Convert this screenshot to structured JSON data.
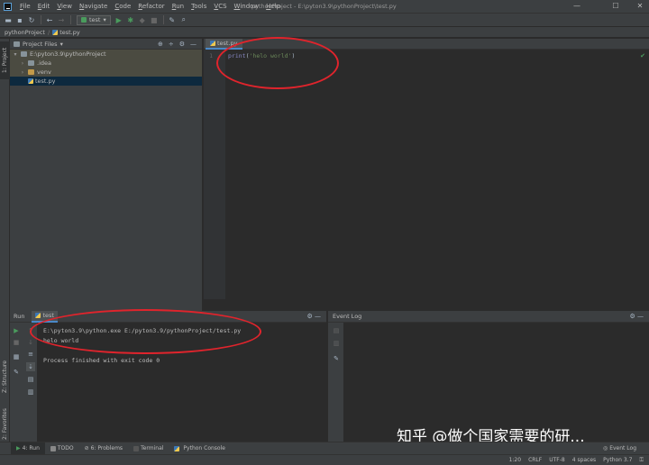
{
  "menubar": {
    "items": [
      "File",
      "Edit",
      "View",
      "Navigate",
      "Code",
      "Refactor",
      "Run",
      "Tools",
      "VCS",
      "Window",
      "Help"
    ],
    "window_title": "pythonProject - E:\\pyton3.9\\pythonProject\\test.py",
    "minimize": "—",
    "maximize": "☐",
    "close": "✕"
  },
  "toolbar": {
    "run_config": "test",
    "run_config_arrow": "▾"
  },
  "breadcrumb": {
    "project": "pythonProject",
    "file": "test.py"
  },
  "left_strip": {
    "project_tab": "1: Project",
    "structure_tab": "Z: Structure",
    "favorites_tab": "2: Favorites"
  },
  "project_panel": {
    "header": "Project Files",
    "header_arrow": "▾",
    "root": "E:\\pyton3.9\\pythonProject",
    "children": [
      ".idea",
      "venv",
      "test.py"
    ]
  },
  "editor": {
    "tab_label": "test.py",
    "line_number": "1",
    "code_fn": "print",
    "code_open": "(",
    "code_string": "'helo world'",
    "code_close": ")"
  },
  "run_panel": {
    "title": "Run",
    "tab_label": "test",
    "console_lines": [
      "E:\\pyton3.9\\python.exe E:/pyton3.9/pythonProject/test.py",
      "helo world",
      "",
      "Process finished with exit code 0"
    ]
  },
  "event_log": {
    "title": "Event Log"
  },
  "tool_tabs": {
    "run": "4: Run",
    "todo": "TODO",
    "problems": "6: Problems",
    "terminal": "Terminal",
    "python_console": "Python Console",
    "event_log": "Event Log"
  },
  "statusbar": {
    "position": "1:20",
    "line_sep": "CRLF",
    "encoding": "UTF-8",
    "indent": "4 spaces",
    "interpreter": "Python 3.7"
  },
  "watermark": "知乎 @做个国家需要的研..."
}
